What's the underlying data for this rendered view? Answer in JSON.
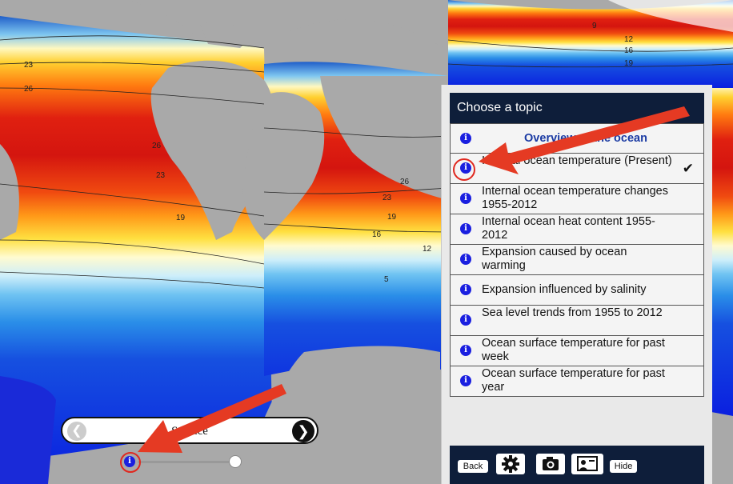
{
  "colors": {
    "panel_dark": "#0e1e3a",
    "info_blue": "#1a1fe0",
    "arrow_red": "#e53a23",
    "land_gray": "#a9a9a9"
  },
  "map": {
    "contour_labels": [
      "9",
      "12",
      "16",
      "19",
      "23",
      "26",
      "26",
      "23",
      "19",
      "26",
      "23",
      "19",
      "16",
      "12",
      "5"
    ]
  },
  "panel": {
    "title": "Choose a topic",
    "topics": [
      {
        "label": "Overview of the ocean",
        "icon": "info-icon"
      },
      {
        "label": "Internal ocean temperature (Present)",
        "icon": "info-icon",
        "selected": true
      },
      {
        "label": "Internal ocean temperature changes 1955-2012",
        "icon": "info-icon"
      },
      {
        "label": "Internal ocean heat content 1955-2012",
        "icon": "info-icon"
      },
      {
        "label": "Expansion caused by ocean warming",
        "icon": "info-icon"
      },
      {
        "label": "Expansion influenced by salinity",
        "icon": "info-icon"
      },
      {
        "label": "Sea level trends from 1955 to 2012",
        "icon": "info-icon"
      },
      {
        "label": "Ocean surface temperature for past week",
        "icon": "info-icon"
      },
      {
        "label": "Ocean surface temperature for past year",
        "icon": "info-icon"
      }
    ],
    "toolbar": {
      "back_label": "Back",
      "hide_label": "Hide"
    }
  },
  "depth": {
    "label": "Surface"
  }
}
